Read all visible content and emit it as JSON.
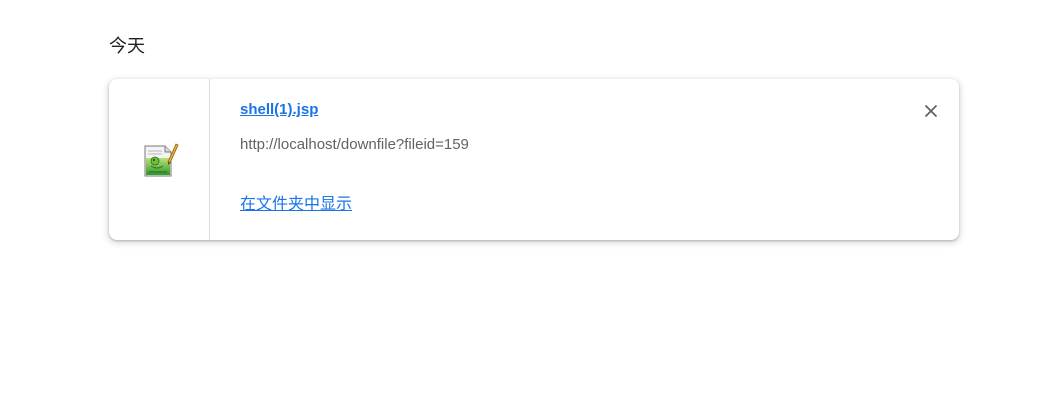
{
  "section": {
    "heading": "今天"
  },
  "download": {
    "file_name": "shell(1).jsp",
    "url": "http://localhost/downfile?fileid=159",
    "show_in_folder_label": "在文件夹中显示",
    "icon": "notepad-file-icon",
    "close_icon": "close-icon"
  },
  "colors": {
    "link": "#1a73e8",
    "secondary_text": "#5f6368",
    "divider": "#dadce0"
  }
}
